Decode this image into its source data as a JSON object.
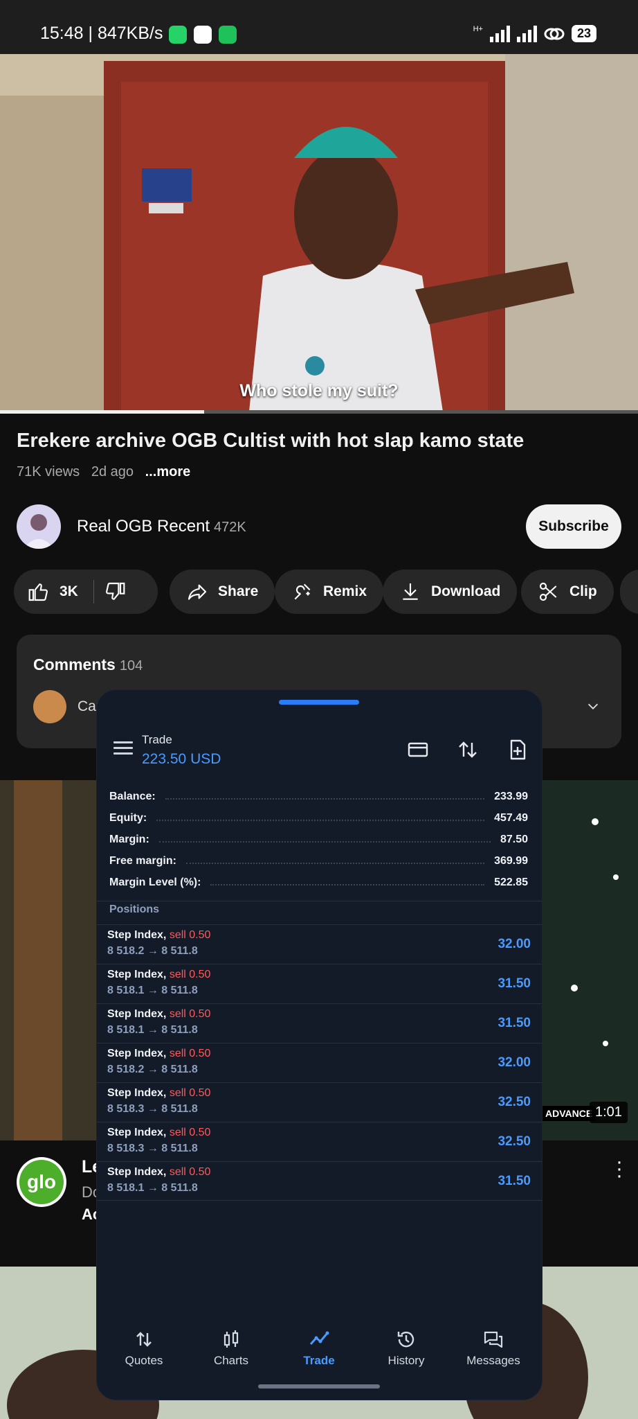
{
  "status_bar": {
    "time_speed": "15:48 | 847KB/s",
    "battery": "23",
    "network_label": "H+"
  },
  "video": {
    "subtitle": "Who stole my suit?",
    "progress_percent": 32,
    "title": "Erekere archive OGB Cultist with hot slap kamo state",
    "views": "71K views",
    "age": "2d ago",
    "more": "...more"
  },
  "channel": {
    "name": "Real OGB Recent",
    "subscribers": "472K",
    "subscribe_label": "Subscribe"
  },
  "actions": {
    "likes": "3K",
    "share": "Share",
    "remix": "Remix",
    "download": "Download",
    "clip": "Clip"
  },
  "comments": {
    "title": "Comments",
    "count": "104",
    "preview_fragment": "Car"
  },
  "next_video": {
    "duration": "1:01",
    "badge": "ADVANCE",
    "title_fragment": "Le",
    "line2_fragment": "Do",
    "line3_fragment": "Ac",
    "channel_logo_text": "glo"
  },
  "trade_app": {
    "header_label": "Trade",
    "balance_value": "223.50 USD",
    "account": [
      {
        "label": "Balance:",
        "value": "233.99"
      },
      {
        "label": "Equity:",
        "value": "457.49"
      },
      {
        "label": "Margin:",
        "value": "87.50"
      },
      {
        "label": "Free margin:",
        "value": "369.99"
      },
      {
        "label": "Margin Level (%):",
        "value": "522.85"
      }
    ],
    "positions_header": "Positions",
    "positions": [
      {
        "symbol": "Step Index,",
        "side": "sell 0.50",
        "prices": "8 518.2 → 8 511.8",
        "profit": "32.00"
      },
      {
        "symbol": "Step Index,",
        "side": "sell 0.50",
        "prices": "8 518.1 → 8 511.8",
        "profit": "31.50"
      },
      {
        "symbol": "Step Index,",
        "side": "sell 0.50",
        "prices": "8 518.1 → 8 511.8",
        "profit": "31.50"
      },
      {
        "symbol": "Step Index,",
        "side": "sell 0.50",
        "prices": "8 518.2 → 8 511.8",
        "profit": "32.00"
      },
      {
        "symbol": "Step Index,",
        "side": "sell 0.50",
        "prices": "8 518.3 → 8 511.8",
        "profit": "32.50"
      },
      {
        "symbol": "Step Index,",
        "side": "sell 0.50",
        "prices": "8 518.3 → 8 511.8",
        "profit": "32.50"
      },
      {
        "symbol": "Step Index,",
        "side": "sell 0.50",
        "prices": "8 518.1 → 8 511.8",
        "profit": "31.50"
      }
    ],
    "nav": [
      {
        "label": "Quotes",
        "icon": "quotes-icon"
      },
      {
        "label": "Charts",
        "icon": "charts-icon"
      },
      {
        "label": "Trade",
        "icon": "trade-icon",
        "active": true
      },
      {
        "label": "History",
        "icon": "history-icon"
      },
      {
        "label": "Messages",
        "icon": "messages-icon"
      }
    ],
    "colors": {
      "accent": "#4a9bff",
      "sell": "#ff5a5a",
      "panel": "#131b29"
    }
  }
}
